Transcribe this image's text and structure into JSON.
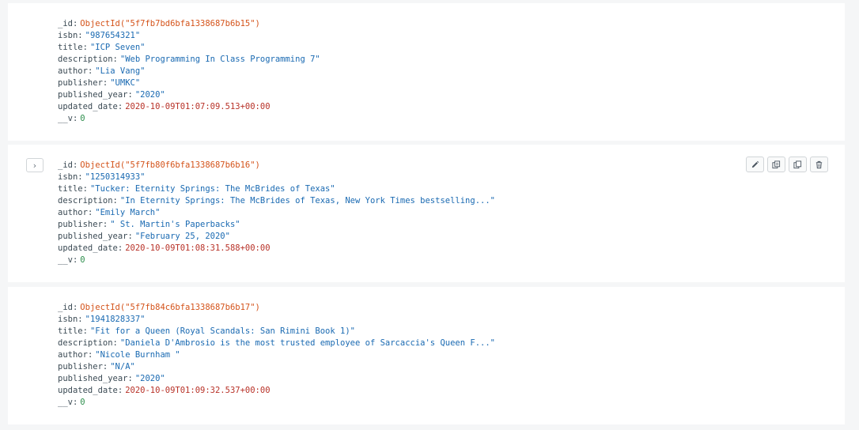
{
  "documents": [
    {
      "fields": [
        {
          "key": "_id",
          "value": "ObjectId(\"5f7fb7bd6bfa1338687b6b15\")",
          "type": "oid"
        },
        {
          "key": "isbn",
          "value": "\"987654321\"",
          "type": "str"
        },
        {
          "key": "title",
          "value": "\"ICP Seven\"",
          "type": "str"
        },
        {
          "key": "description",
          "value": "\"Web Programming In Class Programming 7\"",
          "type": "str"
        },
        {
          "key": "author",
          "value": "\"Lia Vang\"",
          "type": "str"
        },
        {
          "key": "publisher",
          "value": "\"UMKC\"",
          "type": "str"
        },
        {
          "key": "published_year",
          "value": "\"2020\"",
          "type": "str"
        },
        {
          "key": "updated_date",
          "value": "2020-10-09T01:07:09.513+00:00",
          "type": "date"
        },
        {
          "key": "__v",
          "value": "0",
          "type": "num"
        }
      ]
    },
    {
      "expand_label": "›",
      "fields": [
        {
          "key": "_id",
          "value": "ObjectId(\"5f7fb80f6bfa1338687b6b16\")",
          "type": "oid"
        },
        {
          "key": "isbn",
          "value": "\"1250314933\"",
          "type": "str"
        },
        {
          "key": "title",
          "value": "\"Tucker: Eternity Springs: The McBrides of Texas\"",
          "type": "str"
        },
        {
          "key": "description",
          "value": "\"In Eternity Springs: The McBrides of Texas, New York Times bestselling...\"",
          "type": "str"
        },
        {
          "key": "author",
          "value": "\"Emily March\"",
          "type": "str"
        },
        {
          "key": "publisher",
          "value": "\" St. Martin's Paperbacks\"",
          "type": "str"
        },
        {
          "key": "published_year",
          "value": "\"February 25, 2020\"",
          "type": "str"
        },
        {
          "key": "updated_date",
          "value": "2020-10-09T01:08:31.588+00:00",
          "type": "date"
        },
        {
          "key": "__v",
          "value": "0",
          "type": "num"
        }
      ]
    },
    {
      "fields": [
        {
          "key": "_id",
          "value": "ObjectId(\"5f7fb84c6bfa1338687b6b17\")",
          "type": "oid"
        },
        {
          "key": "isbn",
          "value": "\"1941828337\"",
          "type": "str"
        },
        {
          "key": "title",
          "value": "\"Fit for a Queen (Royal Scandals: San Rimini Book 1)\"",
          "type": "str"
        },
        {
          "key": "description",
          "value": "\"Daniela D'Ambrosio is the most trusted employee of Sarcaccia's Queen F...\"",
          "type": "str"
        },
        {
          "key": "author",
          "value": "\"Nicole Burnham \"",
          "type": "str"
        },
        {
          "key": "publisher",
          "value": "\"N/A\"",
          "type": "str"
        },
        {
          "key": "published_year",
          "value": "\"2020\"",
          "type": "str"
        },
        {
          "key": "updated_date",
          "value": "2020-10-09T01:09:32.537+00:00",
          "type": "date"
        },
        {
          "key": "__v",
          "value": "0",
          "type": "num"
        }
      ]
    }
  ],
  "actions": [
    {
      "icon": "pencil-icon",
      "name": "edit-document-button"
    },
    {
      "icon": "copy-icon",
      "name": "copy-document-button"
    },
    {
      "icon": "clone-icon",
      "name": "clone-document-button"
    },
    {
      "icon": "trash-icon",
      "name": "delete-document-button"
    }
  ],
  "colors": {
    "oid": "#d4531a",
    "string": "#1a6ab2",
    "date": "#b83228",
    "number": "#2f8f4e",
    "key": "#3b4a54"
  }
}
